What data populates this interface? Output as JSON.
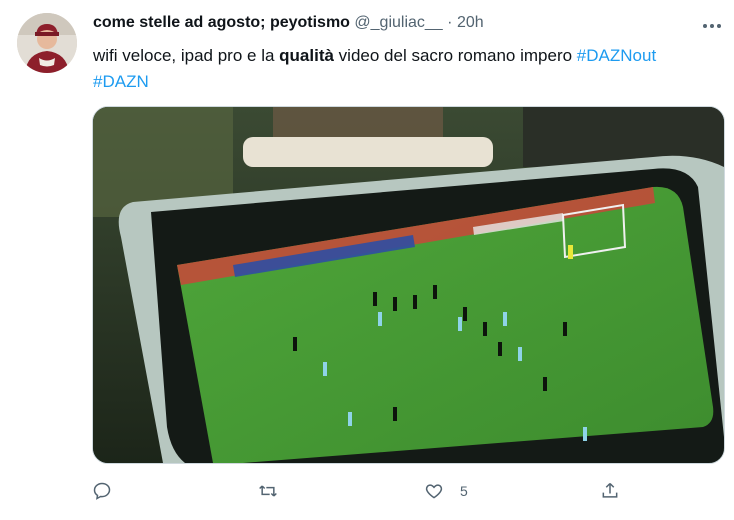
{
  "tweet": {
    "display_name": "come stelle ad agosto; peyotismo",
    "handle": "@_giuliac__",
    "separator": "·",
    "time": "20h",
    "text_parts": {
      "p1": "wifi veloce, ipad pro e la ",
      "bold": "qualità",
      "p2": " video del sacro romano impero ",
      "hashtag1": "#DAZNout",
      "hashtag2": "#DAZN"
    },
    "media_alt": "tablet showing a football match broadcast",
    "actions": {
      "reply_count": "",
      "retweet_count": "",
      "like_count": "5",
      "share_count": ""
    }
  },
  "colors": {
    "link": "#1d9bf0",
    "secondary": "#536471",
    "text": "#0f1419"
  },
  "icons": [
    "avatar",
    "more-icon",
    "reply-icon",
    "retweet-icon",
    "like-icon",
    "share-icon"
  ]
}
